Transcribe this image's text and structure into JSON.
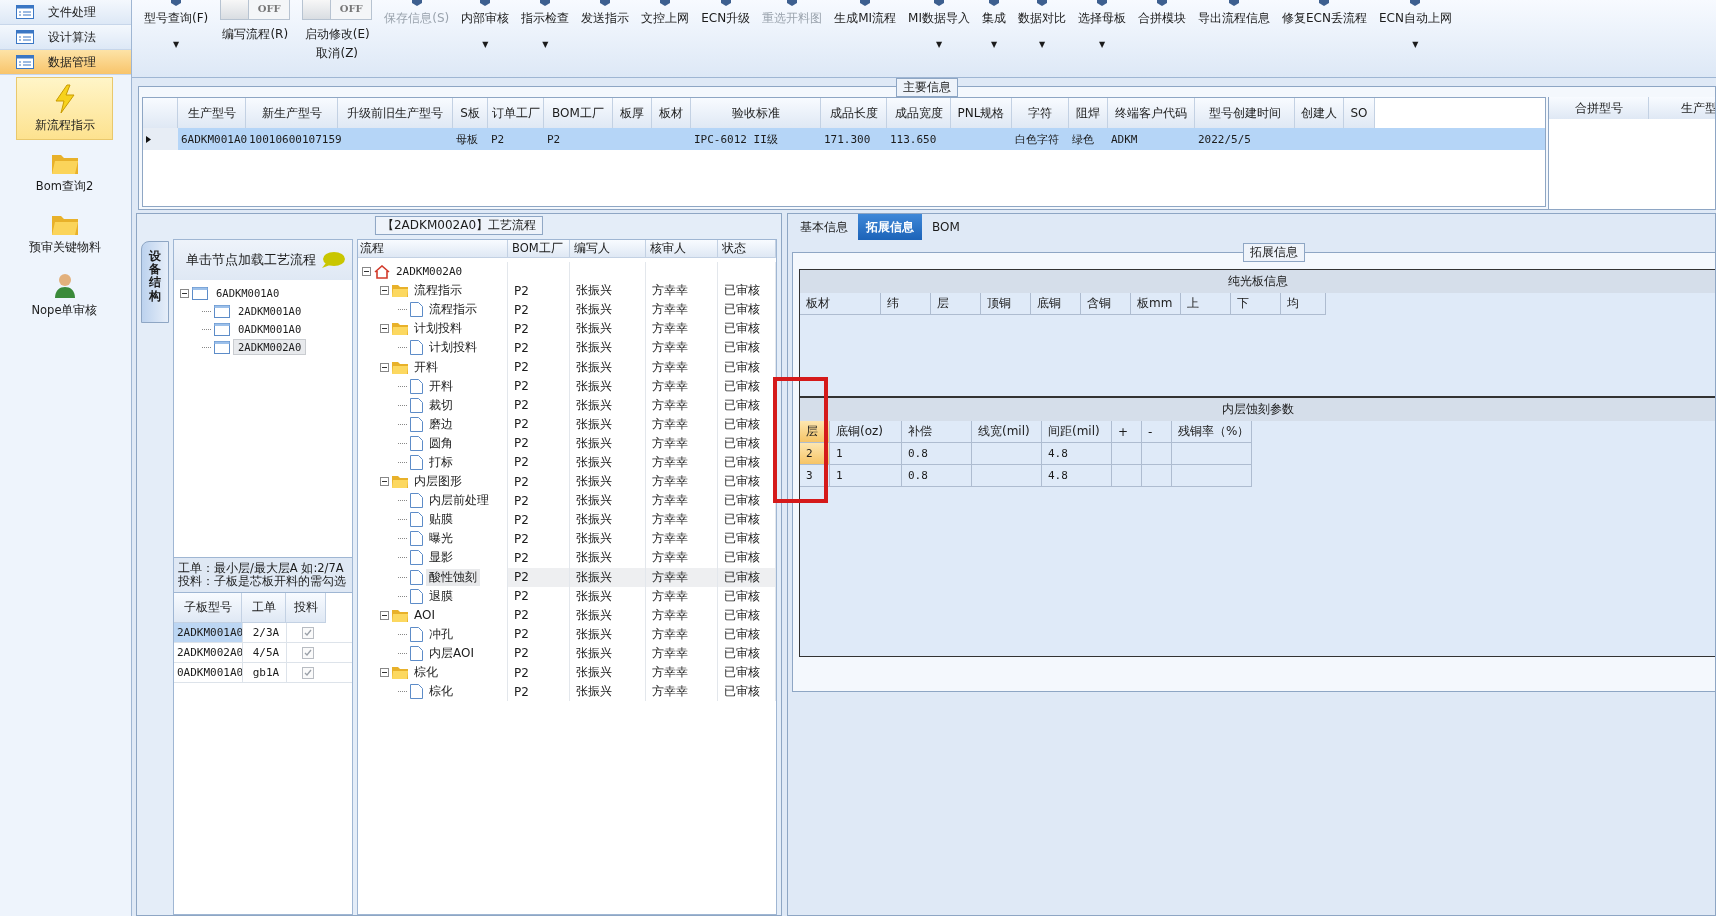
{
  "sidebar": {
    "menu": [
      {
        "label": "文件处理",
        "selected": false
      },
      {
        "label": "设计算法",
        "selected": false
      },
      {
        "label": "数据管理",
        "selected": true
      }
    ],
    "tools": [
      {
        "kind": "bolt",
        "label": "新流程指示",
        "selected": true
      },
      {
        "kind": "folder",
        "label": "Bom查询2",
        "selected": false
      },
      {
        "kind": "folder",
        "label": "预审关键物料",
        "selected": false
      },
      {
        "kind": "person",
        "label": "Nope单审核",
        "selected": false
      }
    ]
  },
  "toolbar": [
    {
      "kind": "button",
      "label": "型号查询(F)",
      "caret": "▼",
      "disabled": false
    },
    {
      "kind": "toggle",
      "label": "编写流程(R)",
      "switch": "OFF",
      "on": false
    },
    {
      "kind": "toggle",
      "label": "启动修改(E)",
      "extra": "取消(Z)",
      "switch": "OFF",
      "on": false
    },
    {
      "kind": "button",
      "label": "保存信息(S)",
      "disabled": true
    },
    {
      "kind": "button",
      "label": "内部审核",
      "caret": "▼",
      "disabled": false
    },
    {
      "kind": "button",
      "label": "指示检查",
      "caret": "▼",
      "disabled": false
    },
    {
      "kind": "button",
      "label": "发送指示",
      "disabled": false
    },
    {
      "kind": "button",
      "label": "文控上网",
      "disabled": false
    },
    {
      "kind": "button",
      "label": "ECN升级",
      "disabled": false
    },
    {
      "kind": "button",
      "label": "重选开料图",
      "disabled": true
    },
    {
      "kind": "button",
      "label": "生成MI流程",
      "disabled": false
    },
    {
      "kind": "button",
      "label": "MI数据导入",
      "caret": "▼",
      "disabled": false
    },
    {
      "kind": "button",
      "label": "集成",
      "caret": "▼",
      "disabled": false
    },
    {
      "kind": "button",
      "label": "数据对比",
      "caret": "▼",
      "disabled": false
    },
    {
      "kind": "button",
      "label": "选择母板",
      "caret": "▼",
      "disabled": false
    },
    {
      "kind": "button",
      "label": "合拼模块",
      "disabled": false
    },
    {
      "kind": "button",
      "label": "导出流程信息",
      "disabled": false
    },
    {
      "kind": "button",
      "label": "修复ECN丢流程",
      "disabled": false
    },
    {
      "kind": "button",
      "label": "ECN自动上网",
      "caret": "▼",
      "disabled": false
    }
  ],
  "main_info": {
    "title": "主要信息",
    "columns": [
      "生产型号",
      "新生产型号",
      "升级前旧生产型号",
      "S板",
      "订单工厂",
      "BOM工厂",
      "板厚",
      "板材",
      "验收标准",
      "成品长度",
      "成品宽度",
      "PNL规格",
      "字符",
      "阻焊",
      "终端客户代码",
      "型号创建时间",
      "创建人",
      "SO"
    ],
    "rows": [
      {
        "selected": true,
        "cells": [
          "6ADKM001A0",
          "10010600107159",
          "",
          "母板",
          "P2",
          "P2",
          "",
          "",
          "IPC-6012 II级",
          "171.300",
          "113.650",
          "",
          "白色字符",
          "绿色",
          "ADKM",
          "2022/5/5",
          "",
          ""
        ]
      }
    ],
    "side_columns": [
      "合拼型号",
      "生产型"
    ]
  },
  "process": {
    "title": "【2ADKM002A0】工艺流程",
    "side_tab": "设备结构",
    "hint": "单击节点加载工艺流程",
    "structure_tree": [
      {
        "label": "6ADKM001A0",
        "expanded": true,
        "selected": false,
        "children": [
          {
            "label": "2ADKM001A0",
            "selected": false
          },
          {
            "label": "0ADKM001A0",
            "selected": false
          },
          {
            "label": "2ADKM002A0",
            "selected": true
          }
        ]
      }
    ],
    "note": "工单：最小层/最大层A 如:2/7A\n投料：子板是芯板开料的需勾选",
    "sub_table": {
      "columns": [
        "子板型号",
        "工单",
        "投料"
      ],
      "rows": [
        {
          "cells": [
            "2ADKM001A0",
            "2/3A"
          ],
          "checked": true,
          "selected": true
        },
        {
          "cells": [
            "2ADKM002A0",
            "4/5A"
          ],
          "checked": true,
          "selected": false
        },
        {
          "cells": [
            "0ADKM001A0",
            "gb1A"
          ],
          "checked": true,
          "selected": false
        }
      ]
    },
    "flow": {
      "columns": [
        "流程",
        "BOM工厂",
        "编写人",
        "核审人",
        "状态"
      ],
      "tree": [
        {
          "kind": "home",
          "label": "2ADKM002A0",
          "expanded": true,
          "selected": false,
          "children": [
            {
              "kind": "folder",
              "label": "流程指示",
              "expanded": true,
              "selected": false,
              "cells": [
                "P2",
                "张振兴",
                "方幸幸",
                "已审核"
              ],
              "children": [
                {
                  "kind": "doc",
                  "label": "流程指示",
                  "selected": false,
                  "cells": [
                    "P2",
                    "张振兴",
                    "方幸幸",
                    "已审核"
                  ]
                }
              ]
            },
            {
              "kind": "folder",
              "label": "计划投料",
              "expanded": true,
              "selected": false,
              "cells": [
                "P2",
                "张振兴",
                "方幸幸",
                "已审核"
              ],
              "children": [
                {
                  "kind": "doc",
                  "label": "计划投料",
                  "selected": false,
                  "cells": [
                    "P2",
                    "张振兴",
                    "方幸幸",
                    "已审核"
                  ]
                }
              ]
            },
            {
              "kind": "folder",
              "label": "开料",
              "expanded": true,
              "selected": false,
              "cells": [
                "P2",
                "张振兴",
                "方幸幸",
                "已审核"
              ],
              "children": [
                {
                  "kind": "doc",
                  "label": "开料",
                  "selected": false,
                  "cells": [
                    "P2",
                    "张振兴",
                    "方幸幸",
                    "已审核"
                  ]
                },
                {
                  "kind": "doc",
                  "label": "裁切",
                  "selected": false,
                  "cells": [
                    "P2",
                    "张振兴",
                    "方幸幸",
                    "已审核"
                  ]
                },
                {
                  "kind": "doc",
                  "label": "磨边",
                  "selected": false,
                  "cells": [
                    "P2",
                    "张振兴",
                    "方幸幸",
                    "已审核"
                  ]
                },
                {
                  "kind": "doc",
                  "label": "圆角",
                  "selected": false,
                  "cells": [
                    "P2",
                    "张振兴",
                    "方幸幸",
                    "已审核"
                  ]
                },
                {
                  "kind": "doc",
                  "label": "打标",
                  "selected": false,
                  "cells": [
                    "P2",
                    "张振兴",
                    "方幸幸",
                    "已审核"
                  ]
                }
              ]
            },
            {
              "kind": "folder",
              "label": "内层图形",
              "expanded": true,
              "selected": false,
              "cells": [
                "P2",
                "张振兴",
                "方幸幸",
                "已审核"
              ],
              "children": [
                {
                  "kind": "doc",
                  "label": "内层前处理",
                  "selected": false,
                  "cells": [
                    "P2",
                    "张振兴",
                    "方幸幸",
                    "已审核"
                  ]
                },
                {
                  "kind": "doc",
                  "label": "贴膜",
                  "selected": false,
                  "cells": [
                    "P2",
                    "张振兴",
                    "方幸幸",
                    "已审核"
                  ]
                },
                {
                  "kind": "doc",
                  "label": "曝光",
                  "selected": false,
                  "cells": [
                    "P2",
                    "张振兴",
                    "方幸幸",
                    "已审核"
                  ]
                },
                {
                  "kind": "doc",
                  "label": "显影",
                  "selected": false,
                  "cells": [
                    "P2",
                    "张振兴",
                    "方幸幸",
                    "已审核"
                  ]
                },
                {
                  "kind": "doc",
                  "label": "酸性蚀刻",
                  "selected": true,
                  "cells": [
                    "P2",
                    "张振兴",
                    "方幸幸",
                    "已审核"
                  ]
                },
                {
                  "kind": "doc",
                  "label": "退膜",
                  "selected": false,
                  "cells": [
                    "P2",
                    "张振兴",
                    "方幸幸",
                    "已审核"
                  ]
                }
              ]
            },
            {
              "kind": "folder",
              "label": "AOI",
              "expanded": true,
              "selected": false,
              "cells": [
                "P2",
                "张振兴",
                "方幸幸",
                "已审核"
              ],
              "children": [
                {
                  "kind": "doc",
                  "label": "冲孔",
                  "selected": false,
                  "cells": [
                    "P2",
                    "张振兴",
                    "方幸幸",
                    "已审核"
                  ]
                },
                {
                  "kind": "doc",
                  "label": "内层AOI",
                  "selected": false,
                  "cells": [
                    "P2",
                    "张振兴",
                    "方幸幸",
                    "已审核"
                  ]
                }
              ]
            },
            {
              "kind": "folder",
              "label": "棕化",
              "expanded": true,
              "selected": false,
              "cells": [
                "P2",
                "张振兴",
                "方幸幸",
                "已审核"
              ],
              "children": [
                {
                  "kind": "doc",
                  "label": "棕化",
                  "selected": false,
                  "cells": [
                    "P2",
                    "张振兴",
                    "方幸幸",
                    "已审核"
                  ]
                }
              ]
            }
          ]
        }
      ]
    }
  },
  "detail": {
    "tabs": [
      {
        "label": "基本信息",
        "selected": false
      },
      {
        "label": "拓展信息",
        "selected": true
      },
      {
        "label": "BOM",
        "selected": false
      }
    ],
    "group_title": "拓展信息",
    "sections": [
      {
        "title": "纯光板信息",
        "columns": [
          "板材",
          "纬",
          "层",
          "顶铜",
          "底铜",
          "含铜",
          "板mm",
          "上",
          "下",
          "均"
        ]
      },
      {
        "title": "内层蚀刻参数",
        "columns": [
          "层",
          "底铜(oz)",
          "补偿",
          "线宽(mil)",
          "间距(mil)",
          "+",
          "-",
          "残铜率（%）"
        ],
        "rows": [
          {
            "selected": true,
            "cells": [
              "2",
              "1",
              "0.8",
              "",
              "4.8",
              "",
              "",
              ""
            ]
          },
          {
            "selected": false,
            "cells": [
              "3",
              "1",
              "0.8",
              "",
              "4.8",
              "",
              "",
              ""
            ]
          }
        ]
      }
    ]
  },
  "annotation": {
    "kind": "highlight"
  }
}
